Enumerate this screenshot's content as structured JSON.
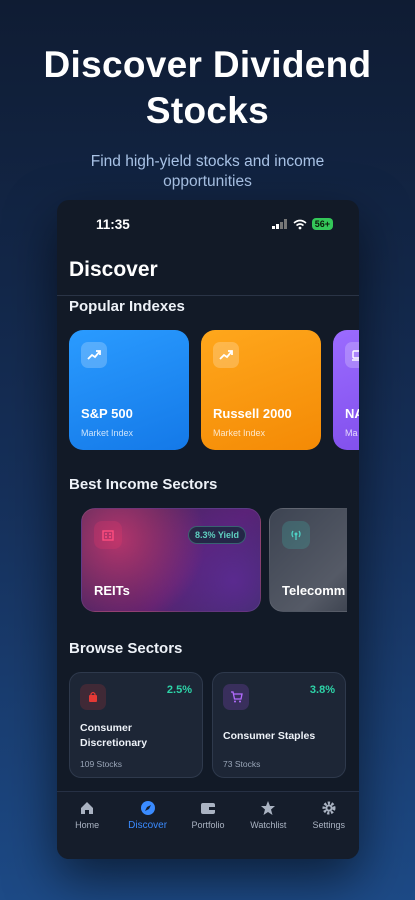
{
  "promo": {
    "title_line1": "Discover Dividend",
    "title_line2": "Stocks",
    "subtitle_line1": "Find high-yield stocks and income",
    "subtitle_line2": "opportunities"
  },
  "status_bar": {
    "time": "11:35",
    "battery": "56+"
  },
  "header": {
    "title": "Discover"
  },
  "popular_indexes": {
    "title": "Popular Indexes",
    "items": [
      {
        "name": "S&P 500",
        "subtitle": "Market Index",
        "icon": "trending-up-icon",
        "color": "#1e90ff"
      },
      {
        "name": "Russell 2000",
        "subtitle": "Market Index",
        "icon": "trending-up-icon",
        "color": "#ff9b0f"
      },
      {
        "name": "NA",
        "subtitle": "Ma",
        "icon": "laptop-icon",
        "color": "#8a5cf6"
      }
    ]
  },
  "income_sectors": {
    "title": "Best Income Sectors",
    "items": [
      {
        "name": "REITs",
        "yield": "8.3% Yield",
        "icon": "building-icon"
      },
      {
        "name": "Telecomm",
        "icon": "broadcast-icon"
      }
    ]
  },
  "browse_sectors": {
    "title": "Browse Sectors",
    "items": [
      {
        "name_line1": "Consumer",
        "name_line2": "Discretionary",
        "pct": "2.5%",
        "count": "109 Stocks",
        "icon": "bag-icon",
        "accent": "#e53935"
      },
      {
        "name_line1": "Consumer Staples",
        "name_line2": "",
        "pct": "3.8%",
        "count": "73 Stocks",
        "icon": "cart-icon",
        "accent": "#a855f7"
      }
    ]
  },
  "tabs": [
    {
      "label": "Home",
      "icon": "home-icon",
      "active": false
    },
    {
      "label": "Discover",
      "icon": "compass-icon",
      "active": true
    },
    {
      "label": "Portfolio",
      "icon": "wallet-icon",
      "active": false
    },
    {
      "label": "Watchlist",
      "icon": "star-icon",
      "active": false
    },
    {
      "label": "Settings",
      "icon": "gear-icon",
      "active": false
    }
  ],
  "colors": {
    "accent": "#3a8bff",
    "positive": "#2dd4a8"
  }
}
